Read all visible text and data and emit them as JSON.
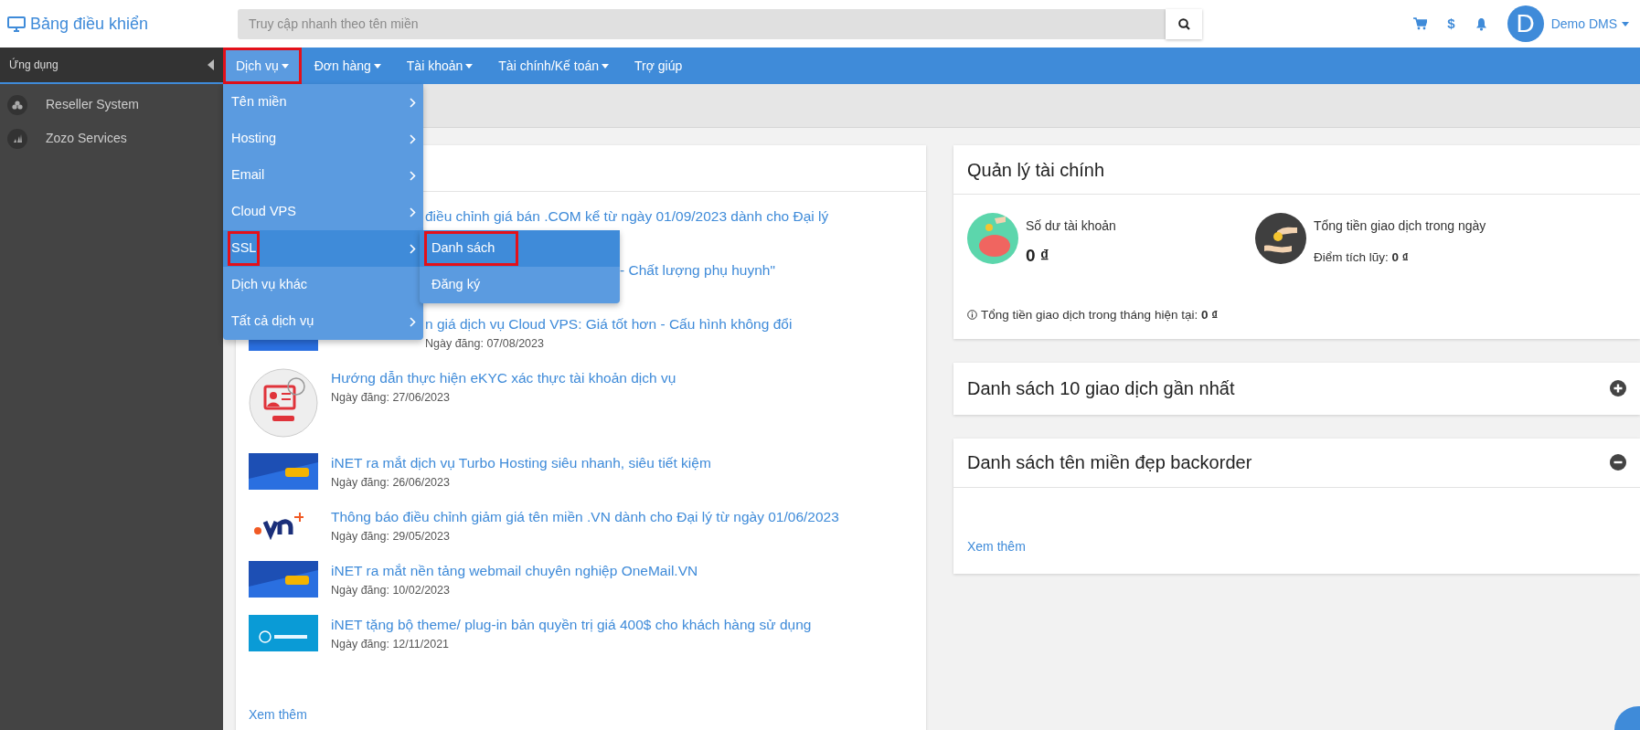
{
  "header": {
    "logo": "Bảng điều khiển",
    "balance_icon": "$",
    "search": {
      "placeholder": "Truy cập nhanh theo tên miền"
    },
    "user": {
      "initial": "D",
      "name": "Demo DMS"
    }
  },
  "sidebar": {
    "title": "Ứng dụng",
    "items": [
      {
        "label": "Reseller System"
      },
      {
        "label": "Zozo Services"
      }
    ]
  },
  "nav": {
    "items": [
      {
        "label": "Dịch vụ",
        "caret": true,
        "selected": true,
        "marked": true
      },
      {
        "label": "Đơn hàng",
        "caret": true,
        "selected": false,
        "marked": false
      },
      {
        "label": "Tài khoản",
        "caret": true,
        "selected": false,
        "marked": false
      },
      {
        "label": "Tài chính/Kế toán",
        "caret": true,
        "selected": false,
        "marked": false
      },
      {
        "label": "Trợ giúp",
        "caret": false,
        "selected": false,
        "marked": false
      }
    ]
  },
  "dropdown": {
    "items": [
      {
        "label": "Tên miền",
        "submenu": true,
        "selected": false,
        "marked": false
      },
      {
        "label": "Hosting",
        "submenu": true,
        "selected": false,
        "marked": false
      },
      {
        "label": "Email",
        "submenu": true,
        "selected": false,
        "marked": false
      },
      {
        "label": "Cloud VPS",
        "submenu": true,
        "selected": false,
        "marked": false
      },
      {
        "label": "SSL",
        "submenu": true,
        "selected": true,
        "marked": true
      },
      {
        "label": "Dịch vụ khác",
        "submenu": false,
        "selected": false,
        "marked": false
      },
      {
        "label": "Tất cả dịch vụ",
        "submenu": true,
        "selected": false,
        "marked": false
      }
    ]
  },
  "submenu": {
    "items": [
      {
        "label": "Danh sách",
        "selected": true,
        "marked": true
      },
      {
        "label": "Đăng ký",
        "selected": false,
        "marked": false
      }
    ]
  },
  "news": {
    "items": [
      {
        "kind": "under-menu",
        "title": "điều chỉnh giá bán .COM kể từ ngày 01/09/2023 dành cho Đại lý"
      },
      {
        "kind": "under-submenu",
        "title": "- Chất lượng phụ huynh\""
      },
      {
        "kind": "under-menu",
        "thumbnail": {
          "kind": "dark-banner"
        },
        "title": "n giá dịch vụ Cloud VPS: Giá tốt hơn - Cấu hình không đổi",
        "date": "Ngày đăng: 07/08/2023"
      },
      {
        "kind": "full",
        "thumbnail": {
          "kind": "round"
        },
        "title": "Hướng dẫn thực hiện eKYC xác thực tài khoản dịch vụ",
        "date": "Ngày đăng: 27/06/2023"
      },
      {
        "kind": "full",
        "thumbnail": {
          "kind": "dark-banner"
        },
        "title": "iNET ra mắt dịch vụ Turbo Hosting siêu nhanh, siêu tiết kiệm",
        "date": "Ngày đăng: 26/06/2023"
      },
      {
        "kind": "full",
        "thumbnail": {
          "kind": "light-logo"
        },
        "title": "Thông báo điều chỉnh giảm giá tên miền .VN dành cho Đại lý từ ngày 01/06/2023",
        "date": "Ngày đăng: 29/05/2023"
      },
      {
        "kind": "full",
        "thumbnail": {
          "kind": "dark-banner"
        },
        "title": "iNET ra mắt nền tảng webmail chuyên nghiệp OneMail.VN",
        "date": "Ngày đăng: 10/02/2023"
      },
      {
        "kind": "full",
        "thumbnail": {
          "kind": "sky-banner"
        },
        "title": "iNET tặng bộ theme/ plug-in bản quyền trị giá 400$ cho khách hàng sử dụng",
        "date": "Ngày đăng: 12/11/2021"
      }
    ],
    "more": "Xem thêm"
  },
  "finance": {
    "title": "Quản lý tài chính",
    "balance_label": "Số dư tài khoản",
    "balance": "0 ₫",
    "day_label": "Tổng tiền giao dịch trong ngày",
    "points": "Điểm tích lũy: **0 ₫**",
    "month": "Tổng tiền giao dịch trong tháng hiện tại: **0 ₫**"
  },
  "panels": [
    {
      "title": "Danh sách 10 giao dịch gần nhất",
      "expanded": false
    },
    {
      "title": "Danh sách tên miền đẹp backorder",
      "expanded": true,
      "more": "Xem thêm"
    }
  ]
}
